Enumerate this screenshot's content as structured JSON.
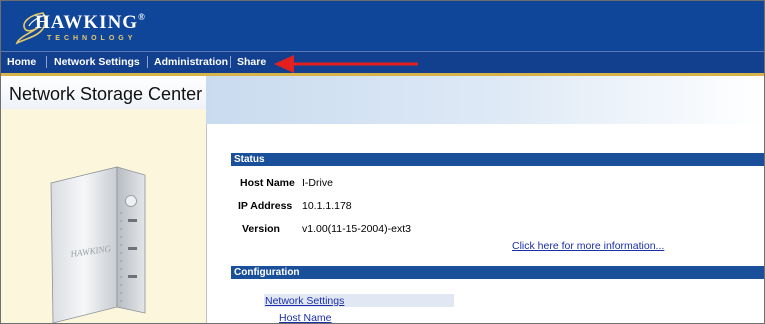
{
  "header": {
    "brand": "HAWKING",
    "registered_mark": "®",
    "tagline": "TECHNOLOGY"
  },
  "nav": {
    "items": [
      {
        "label": "Home"
      },
      {
        "label": "Network Settings"
      },
      {
        "label": "Administration"
      },
      {
        "label": "Share"
      }
    ]
  },
  "annotation": {
    "color": "#e32020"
  },
  "left_panel": {
    "title": "Network Storage Center",
    "device_brand": "HAWKING"
  },
  "status": {
    "title": "Status",
    "rows": [
      {
        "label": "Host Name",
        "value": "I-Drive"
      },
      {
        "label": "IP Address",
        "value": "10.1.1.178"
      },
      {
        "label": "Version",
        "value": "v1.00(11-15-2004)-ext3"
      }
    ],
    "more_info_link": "Click here for more information..."
  },
  "configuration": {
    "title": "Configuration",
    "links": [
      {
        "label": "Network Settings"
      },
      {
        "label": "Host Name"
      }
    ]
  },
  "colors": {
    "header_blue": "#10469a",
    "nav_blue": "#123f8e",
    "gold": "#d8b349",
    "section_blue": "#1a4f99",
    "link": "#1b2fa8",
    "left_panel": "#fbf6dc"
  }
}
